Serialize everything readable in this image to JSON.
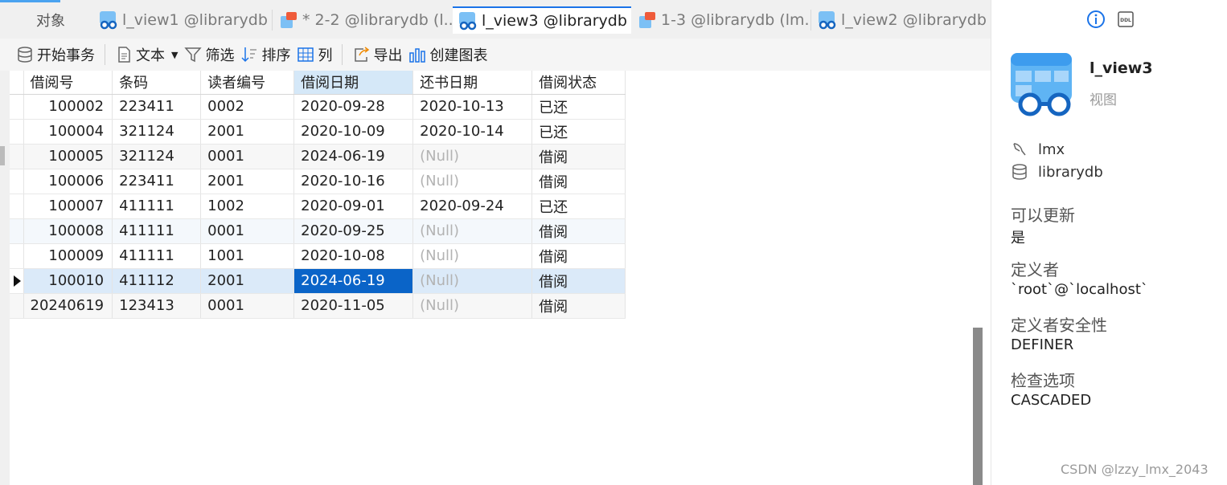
{
  "tabs": {
    "objects_label": "对象",
    "items": [
      {
        "label": "l_view1 @librarydb ...",
        "kind": "view",
        "active": false
      },
      {
        "label": "* 2-2 @librarydb (l...",
        "kind": "query",
        "active": false
      },
      {
        "label": "l_view3 @librarydb ...",
        "kind": "view",
        "active": true
      },
      {
        "label": "1-3 @librarydb (lm...",
        "kind": "query",
        "active": false
      },
      {
        "label": "l_view2 @librarydb ...",
        "kind": "view",
        "active": false
      }
    ]
  },
  "toolbar": {
    "begin_transaction": "开始事务",
    "text": "文本",
    "filter": "筛选",
    "sort": "排序",
    "columns": "列",
    "export": "导出",
    "create_chart": "创建图表"
  },
  "grid": {
    "columns": [
      "借阅号",
      "条码",
      "读者编号",
      "借阅日期",
      "还书日期",
      "借阅状态"
    ],
    "rows": [
      [
        "100002",
        "223411",
        "0002",
        "2020-09-28",
        "2020-10-13",
        "已还"
      ],
      [
        "100004",
        "321124",
        "2001",
        "2020-10-09",
        "2020-10-14",
        "已还"
      ],
      [
        "100005",
        "321124",
        "0001",
        "2024-06-19",
        "(Null)",
        "借阅"
      ],
      [
        "100006",
        "223411",
        "2001",
        "2020-10-16",
        "(Null)",
        "借阅"
      ],
      [
        "100007",
        "411111",
        "1002",
        "2020-09-01",
        "2020-09-24",
        "已还"
      ],
      [
        "100008",
        "411111",
        "0001",
        "2020-09-25",
        "(Null)",
        "借阅"
      ],
      [
        "100009",
        "411111",
        "1001",
        "2020-10-08",
        "(Null)",
        "借阅"
      ],
      [
        "100010",
        "411112",
        "2001",
        "2024-06-19",
        "(Null)",
        "借阅"
      ],
      [
        "20240619",
        "123413",
        "0001",
        "2020-11-05",
        "(Null)",
        "借阅"
      ]
    ],
    "selected_row": 7,
    "selected_column": 3
  },
  "info_panel": {
    "view_name": "l_view3",
    "object_type": "视图",
    "user": "lmx",
    "database": "librarydb",
    "properties": [
      {
        "label": "可以更新",
        "value": "是"
      },
      {
        "label": "定义者",
        "value": "`root`@`localhost`"
      },
      {
        "label": "定义者安全性",
        "value": "DEFINER"
      },
      {
        "label": "检查选项",
        "value": "CASCADED"
      }
    ]
  },
  "watermark": "CSDN @lzzy_lmx_2043",
  "colors": {
    "accent": "#0a64c8",
    "selected_row": "#dbeaf9",
    "null_text": "#b3b3b3"
  }
}
